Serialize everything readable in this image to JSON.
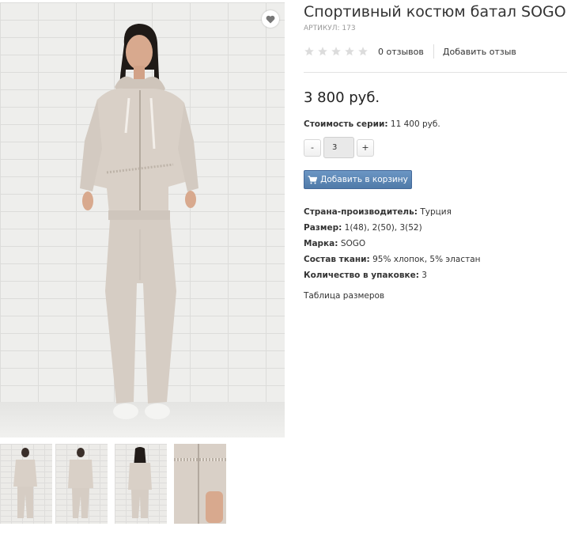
{
  "product": {
    "title": "Спортивный костюм батал SOGO",
    "sku_label": "Артикул:",
    "sku_value": "173",
    "rating_stars": 0,
    "rating_max": 5,
    "reviews_count_text": "0 отзывов",
    "add_review_text": "Добавить отзыв",
    "price": "3 800 руб.",
    "series_label": "Стоимость серии:",
    "series_value": "11 400 руб.",
    "qty_minus": "-",
    "qty_value": "3",
    "qty_plus": "+",
    "add_to_cart": "Добавить в корзину",
    "size_table_link": "Таблица размеров"
  },
  "properties": [
    {
      "label": "Страна-производитель:",
      "value": "Турция"
    },
    {
      "label": "Размер:",
      "value": "1(48), 2(50), 3(52)"
    },
    {
      "label": "Марка:",
      "value": "SOGO"
    },
    {
      "label": "Состав ткани:",
      "value": "95% хлопок, 5% эластан"
    },
    {
      "label": "Количество в упаковке:",
      "value": "3"
    }
  ],
  "icons": {
    "wishlist": "heart-icon",
    "cart": "cart-icon",
    "star": "star-icon"
  },
  "colors": {
    "cart_button": "#5a85b5",
    "star_empty": "#dcdcdc",
    "suit": "#d9d0c7"
  }
}
